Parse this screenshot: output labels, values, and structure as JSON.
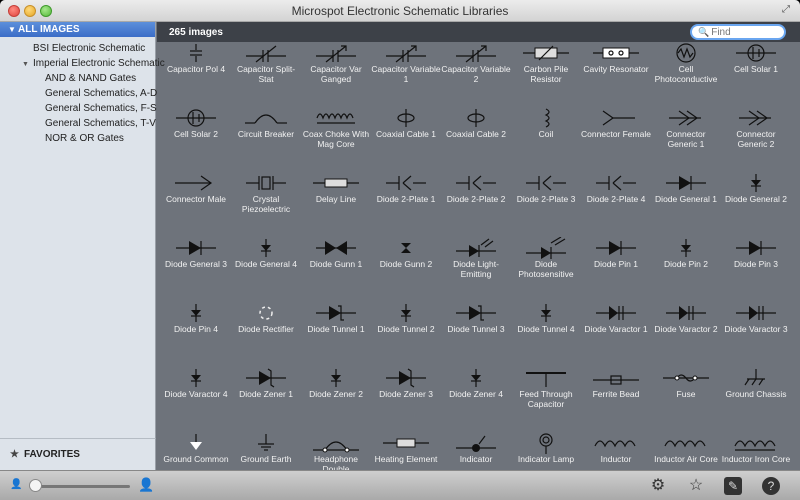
{
  "window": {
    "title": "Microspot Electronic Schematic Libraries"
  },
  "sidebar": {
    "header": "ALL IMAGES",
    "items": [
      {
        "label": "BSI Electronic Schematic"
      },
      {
        "label": "Imperial Electronic Schematic"
      },
      {
        "label": "AND & NAND Gates"
      },
      {
        "label": "General Schematics, A-D"
      },
      {
        "label": "General Schematics, F-S"
      },
      {
        "label": "General Schematics, T-V"
      },
      {
        "label": "NOR & OR Gates"
      }
    ],
    "favorites": "FAVORITES"
  },
  "main": {
    "count": "265 images",
    "search_placeholder": "Find"
  },
  "grid": {
    "rows": [
      [
        "Capacitor Pol 4",
        "Capacitor Split-Stat",
        "Capacitor Var Ganged",
        "Capacitor Variable 1",
        "Capacitor Variable 2",
        "Carbon Pile Resistor",
        "Cavity Resonator",
        "Cell Photoconductive",
        "Cell Solar 1"
      ],
      [
        "Cell Solar 2",
        "Circuit Breaker",
        "Coax Choke With Mag Core",
        "Coaxial Cable 1",
        "Coaxial Cable 2",
        "Coil",
        "Connector Female",
        "Connector Generic 1",
        "Connector Generic 2"
      ],
      [
        "Connector Male",
        "Crystal Piezoelectric",
        "Delay Line",
        "Diode 2-Plate 1",
        "Diode 2-Plate 2",
        "Diode 2-Plate 3",
        "Diode 2-Plate 4",
        "Diode General 1",
        "Diode General 2"
      ],
      [
        "Diode General 3",
        "Diode General 4",
        "Diode Gunn 1",
        "Diode Gunn 2",
        "Diode Light-Emitting",
        "Diode Photosensitive",
        "Diode Pin 1",
        "Diode Pin 2",
        "Diode Pin 3"
      ],
      [
        "Diode Pin 4",
        "Diode Rectifier",
        "Diode Tunnel 1",
        "Diode Tunnel 2",
        "Diode Tunnel 3",
        "Diode Tunnel 4",
        "Diode Varactor 1",
        "Diode Varactor 2",
        "Diode Varactor 3"
      ],
      [
        "Diode Varactor 4",
        "Diode Zener 1",
        "Diode Zener 2",
        "Diode Zener 3",
        "Diode Zener 4",
        "Feed Through Capacitor",
        "Ferrite Bead",
        "Fuse",
        "Ground Chassis"
      ],
      [
        "Ground Common",
        "Ground Earth",
        "Headphone Double",
        "Heating Element",
        "Indicator",
        "Indicator Lamp",
        "Inductor",
        "Inductor Air Core",
        "Inductor Iron Core"
      ]
    ],
    "symbols": [
      [
        "capacitor-icon",
        "capacitor-split-icon",
        "capacitor-var-icon",
        "capacitor-var-icon",
        "capacitor-var-icon",
        "resistor-icon",
        "resonator-icon",
        "photocell-icon",
        "cell-icon"
      ],
      [
        "cell-icon",
        "breaker-icon",
        "coil-icon",
        "coax-icon",
        "coax-icon",
        "coil-vertical-icon",
        "connector-female-icon",
        "connector-icon",
        "connector-icon"
      ],
      [
        "connector-male-icon",
        "crystal-icon",
        "delay-line-icon",
        "diode-plate-icon",
        "diode-plate-icon",
        "diode-plate-icon",
        "diode-plate-icon",
        "diode-icon",
        "diode-small-icon"
      ],
      [
        "diode-icon",
        "diode-small-icon",
        "gunn-icon",
        "gunn-small-icon",
        "led-icon",
        "photodiode-icon",
        "diode-icon",
        "diode-small-icon",
        "diode-icon"
      ],
      [
        "diode-small-icon",
        "rectifier-icon",
        "diode-tunnel-icon",
        "diode-small-icon",
        "diode-tunnel-icon",
        "diode-small-icon",
        "varactor-icon",
        "varactor-icon",
        "varactor-icon"
      ],
      [
        "diode-small-icon",
        "zener-icon",
        "diode-small-icon",
        "zener-icon",
        "diode-small-icon",
        "feedthrough-icon",
        "ferrite-icon",
        "fuse-icon",
        "ground-chassis-icon"
      ],
      [
        "ground-common-icon",
        "ground-earth-icon",
        "headphone-icon",
        "heating-icon",
        "indicator-icon",
        "lamp-icon",
        "inductor-icon",
        "inductor-icon",
        "inductor-core-icon"
      ]
    ]
  },
  "toolbar": {
    "settings": "settings-gear-icon",
    "favorite": "favorite-star-icon",
    "edit": "edit-icon",
    "help_label": "?"
  }
}
